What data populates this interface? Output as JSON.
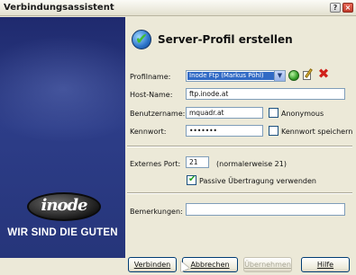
{
  "window": {
    "title": "Verbindungsassistent",
    "help_btn": "?",
    "close_btn": "×"
  },
  "branding": {
    "logo": "inode",
    "slogan": "WIR SIND DIE GUTEN"
  },
  "header": {
    "title": "Server-Profil erstellen"
  },
  "form": {
    "profilname": {
      "label": "Profilname:",
      "value": "Inode Ftp (Markus Pöhl)"
    },
    "hostname": {
      "label": "Host-Name:",
      "value": "ftp.inode.at"
    },
    "benutzername": {
      "label": "Benutzername:",
      "value": "mquadr.at"
    },
    "anonymous": {
      "label": "Anonymous",
      "checked": false
    },
    "kennwort": {
      "label": "Kennwort:",
      "value": "•••••••"
    },
    "kennwort_speichern": {
      "label": "Kennwort speichern",
      "checked": false
    },
    "port": {
      "label": "Externes Port:",
      "value": "21",
      "hint": "(normalerweise 21)"
    },
    "passive": {
      "label": "Passive Übertragung verwenden",
      "checked": true
    },
    "bemerkungen": {
      "label": "Bemerkungen:",
      "value": ""
    }
  },
  "buttons": {
    "verbinden": "Verbinden",
    "abbrechen": "Abbrechen",
    "uebernehmen": "Übernehmen",
    "hilfe": "Hilfe"
  },
  "icons": [
    "globe-icon",
    "edit-icon",
    "delete-icon",
    "wizard-check-icon"
  ]
}
